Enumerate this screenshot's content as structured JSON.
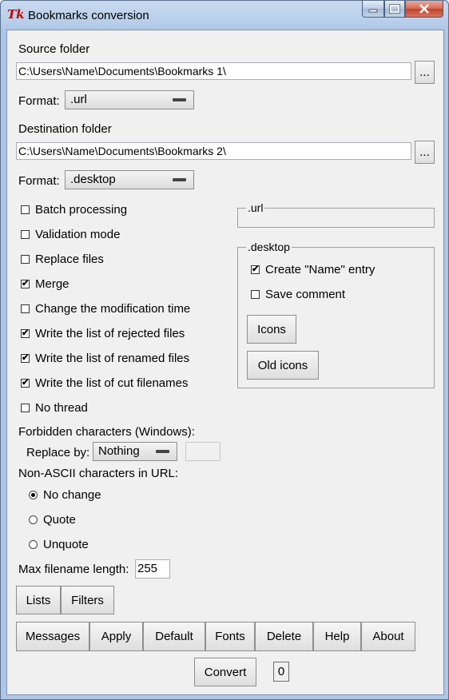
{
  "window": {
    "title": "Bookmarks conversion",
    "icon_text": "Tk"
  },
  "source": {
    "label": "Source folder",
    "path": "C:\\Users\\Name\\Documents\\Bookmarks 1\\",
    "browse_label": "...",
    "format_label": "Format:",
    "format_value": ".url"
  },
  "destination": {
    "label": "Destination folder",
    "path": "C:\\Users\\Name\\Documents\\Bookmarks 2\\",
    "browse_label": "...",
    "format_label": "Format:",
    "format_value": ".desktop"
  },
  "options": [
    {
      "label": "Batch processing",
      "checked": false
    },
    {
      "label": "Validation mode",
      "checked": false
    },
    {
      "label": "Replace files",
      "checked": false
    },
    {
      "label": "Merge",
      "checked": true
    },
    {
      "label": "Change the modification time",
      "checked": false
    },
    {
      "label": "Write the list of rejected files",
      "checked": true
    },
    {
      "label": "Write the list of renamed files",
      "checked": true
    },
    {
      "label": "Write the list of cut filenames",
      "checked": true
    },
    {
      "label": "No thread",
      "checked": false
    }
  ],
  "url_frame": {
    "title": ".url"
  },
  "desktop_frame": {
    "title": ".desktop",
    "create_name_label": "Create \"Name\" entry",
    "create_name_checked": true,
    "save_comment_label": "Save comment",
    "save_comment_checked": false,
    "icons_label": "Icons",
    "old_icons_label": "Old icons"
  },
  "forbidden": {
    "label": "Forbidden characters (Windows):",
    "replace_label": "Replace by:",
    "replace_value": "Nothing",
    "replace_text": ""
  },
  "non_ascii": {
    "label": "Non-ASCII characters in URL:",
    "choices": [
      {
        "label": "No change",
        "selected": true
      },
      {
        "label": "Quote",
        "selected": false
      },
      {
        "label": "Unquote",
        "selected": false
      }
    ]
  },
  "max_filename": {
    "label": "Max filename length:",
    "value": "255"
  },
  "buttons": {
    "lists": "Lists",
    "filters": "Filters",
    "messages": "Messages",
    "apply": "Apply",
    "default": "Default",
    "fonts": "Fonts",
    "delete": "Delete",
    "help": "Help",
    "about": "About",
    "convert": "Convert"
  },
  "counter": "0",
  "check_mark": "✔"
}
